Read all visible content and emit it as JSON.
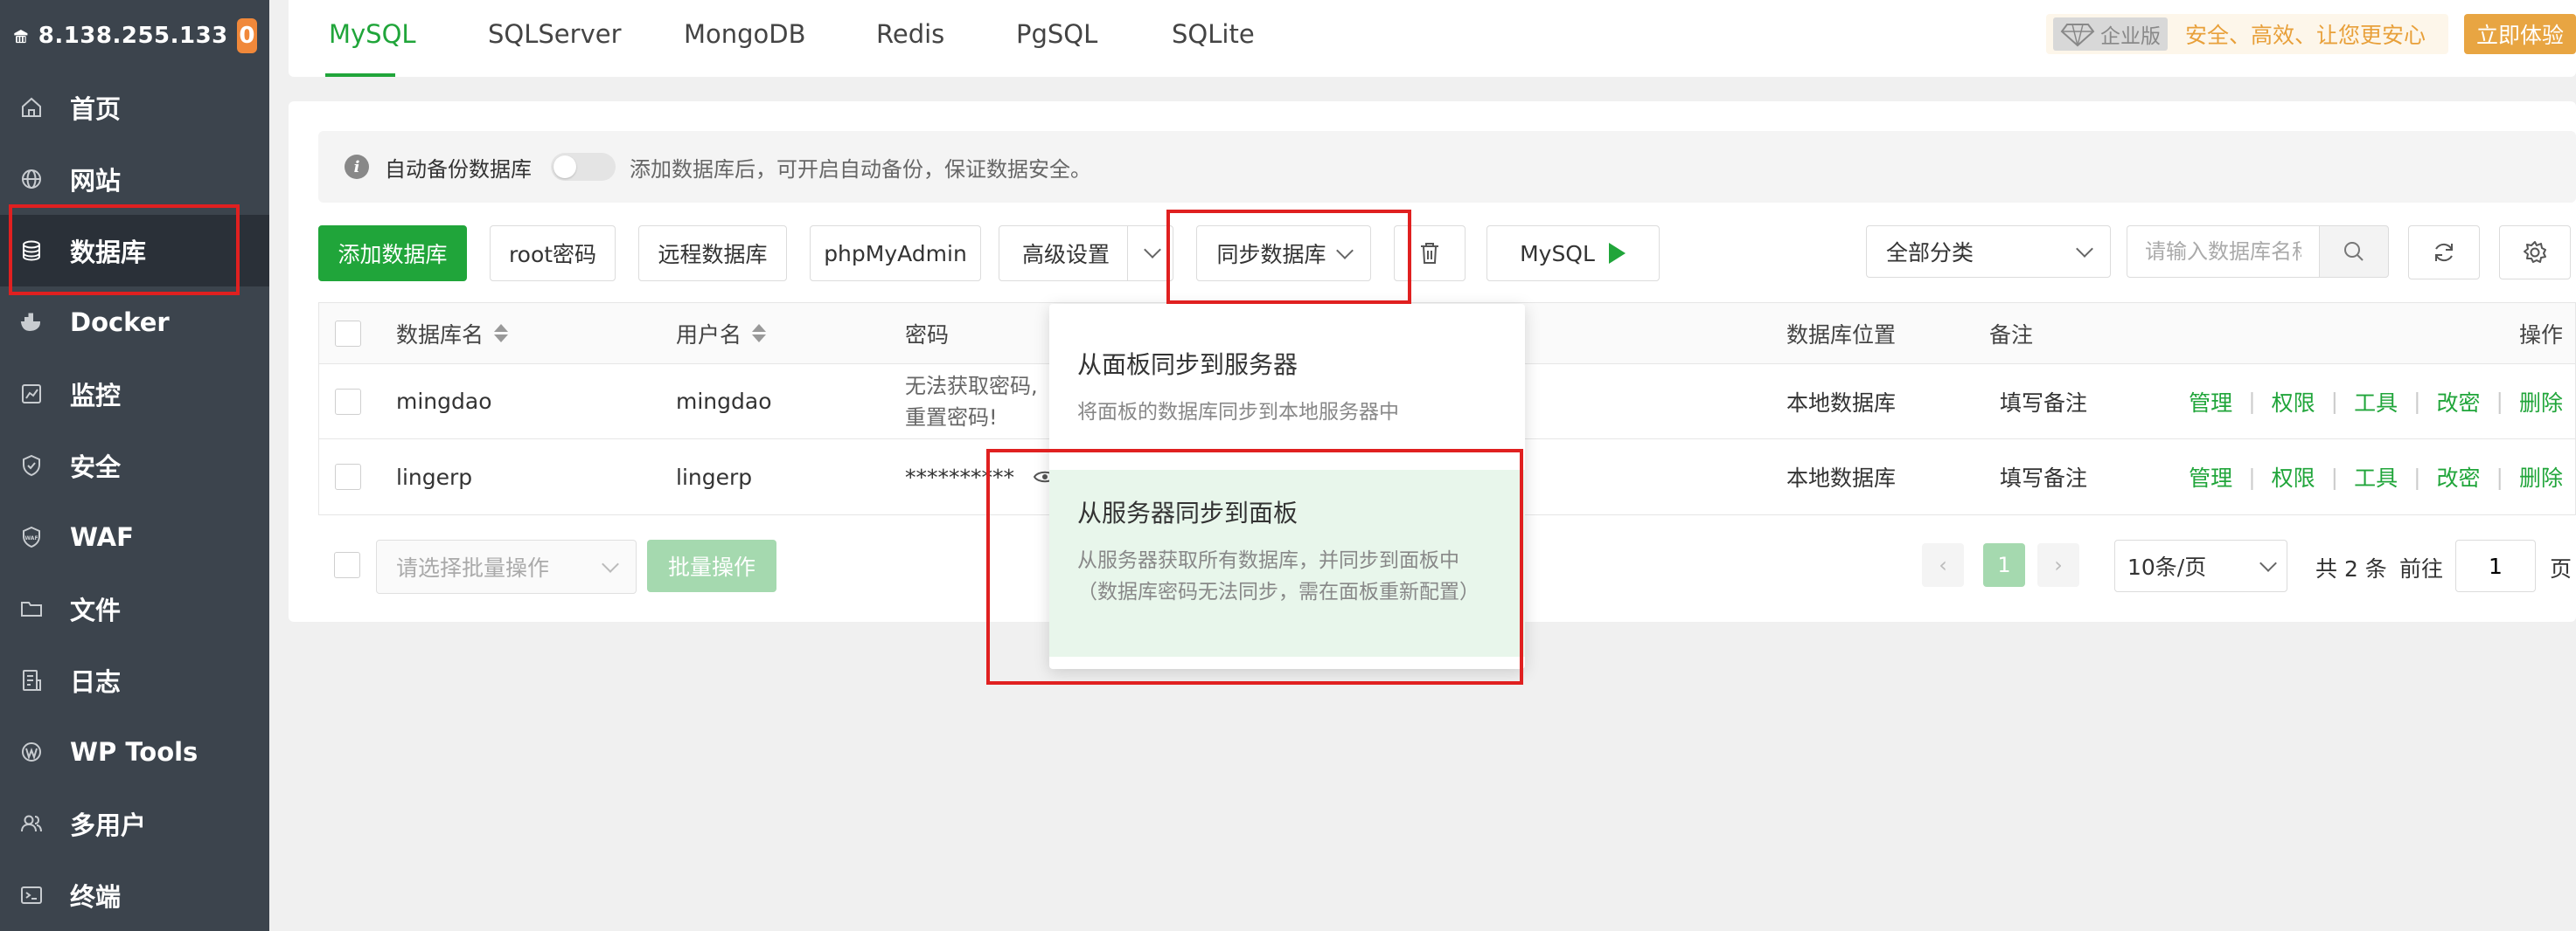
{
  "sidebar": {
    "ip": "8.138.255.133",
    "badge": "0",
    "items": [
      {
        "label": "首页",
        "icon": "home-icon"
      },
      {
        "label": "网站",
        "icon": "globe-icon"
      },
      {
        "label": "数据库",
        "icon": "database-icon"
      },
      {
        "label": "Docker",
        "icon": "docker-icon"
      },
      {
        "label": "监控",
        "icon": "monitor-icon"
      },
      {
        "label": "安全",
        "icon": "shield-icon"
      },
      {
        "label": "WAF",
        "icon": "waf-icon"
      },
      {
        "label": "文件",
        "icon": "folder-icon"
      },
      {
        "label": "日志",
        "icon": "log-icon"
      },
      {
        "label": "WP Tools",
        "icon": "wordpress-icon"
      },
      {
        "label": "多用户",
        "icon": "users-icon"
      },
      {
        "label": "终端",
        "icon": "terminal-icon"
      }
    ],
    "active": "数据库"
  },
  "tabs": [
    "MySQL",
    "SQLServer",
    "MongoDB",
    "Redis",
    "PgSQL",
    "SQLite"
  ],
  "active_tab": "MySQL",
  "promo": {
    "edition": "企业版",
    "text": "安全、高效、让您更安心",
    "cta": "立即体验"
  },
  "notice": {
    "label": "自动备份数据库",
    "hint": "添加数据库后，可开启自动备份，保证数据安全。"
  },
  "toolbar": {
    "add_db": "添加数据库",
    "root_pw": "root密码",
    "remote_db": "远程数据库",
    "phpmyadmin": "phpMyAdmin",
    "advanced": "高级设置",
    "sync_db": "同步数据库",
    "mysql": "MySQL",
    "category": "全部分类",
    "search_placeholder": "请输入数据库名称"
  },
  "table": {
    "headers": {
      "name": "数据库名",
      "user": "用户名",
      "password": "密码",
      "location": "数据库位置",
      "note": "备注",
      "actions": "操作"
    },
    "rows": [
      {
        "name": "mingdao",
        "user": "mingdao",
        "password_line1": "无法获取密码,",
        "password_line2": "重置密码!",
        "location": "本地数据库",
        "note": "填写备注"
      },
      {
        "name": "lingerp",
        "user": "lingerp",
        "password": "**********",
        "location": "本地数据库",
        "note": "填写备注"
      }
    ],
    "actions": [
      "管理",
      "权限",
      "工具",
      "改密",
      "删除"
    ]
  },
  "footer": {
    "batch_placeholder": "请选择批量操作",
    "batch_btn": "批量操作",
    "page": "1",
    "page_size": "10条/页",
    "total": "共 2 条",
    "goto": "前往",
    "goto_value": "1",
    "page_unit": "页"
  },
  "dropdown": {
    "item1_title": "从面板同步到服务器",
    "item1_desc": "将面板的数据库同步到本地服务器中",
    "item2_title": "从服务器同步到面板",
    "item2_desc1": "从服务器获取所有数据库，并同步到面板中",
    "item2_desc2": "（数据库密码无法同步，需在面板重新配置）"
  },
  "colors": {
    "accent": "#20a53a",
    "sidebar": "#3c444d",
    "highlight": "#e02020",
    "warning": "#e8a542"
  }
}
